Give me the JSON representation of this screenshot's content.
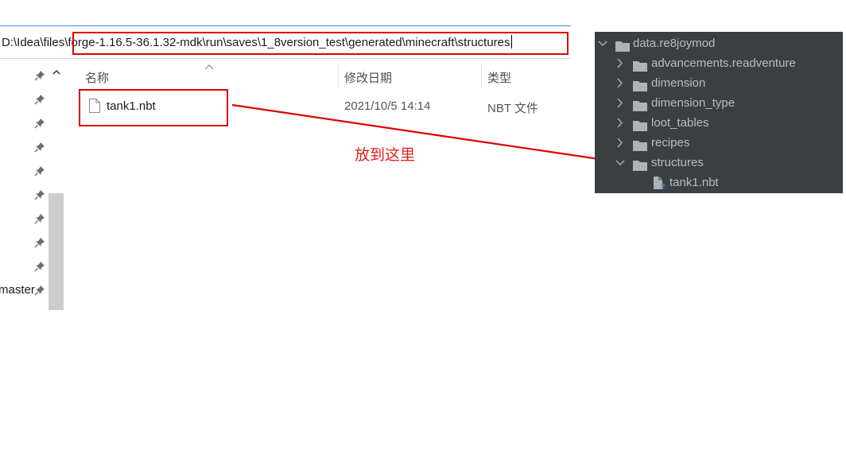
{
  "address_bar": {
    "prefix": "D:\\Idea\\files\\",
    "path": "forge-1.16.5-36.1.32-mdk\\run\\saves\\1_8version_test\\generated\\minecraft\\structures"
  },
  "sidebar": {
    "partial_label": "master"
  },
  "columns": {
    "name": "名称",
    "date": "修改日期",
    "type": "类型"
  },
  "file": {
    "name": "tank1.nbt",
    "date": "2021/10/5 14:14",
    "type": "NBT 文件"
  },
  "annotation": "放到这里",
  "ide_tree": {
    "root": "data.re8joymod",
    "folders": [
      "advancements.readventure",
      "dimension",
      "dimension_type",
      "loot_tables",
      "recipes",
      "structures"
    ],
    "child_file": "tank1.nbt"
  },
  "colors": {
    "highlight": "#e00000",
    "ide_background": "#3c3f41",
    "ide_text": "#bbbbbb",
    "folder_icon": "#aeb3b7"
  },
  "icons": [
    "pin-icon",
    "chevron-up-icon",
    "file-icon",
    "chevron-down-icon",
    "chevron-right-icon",
    "folder-icon",
    "unknown-file-icon"
  ]
}
